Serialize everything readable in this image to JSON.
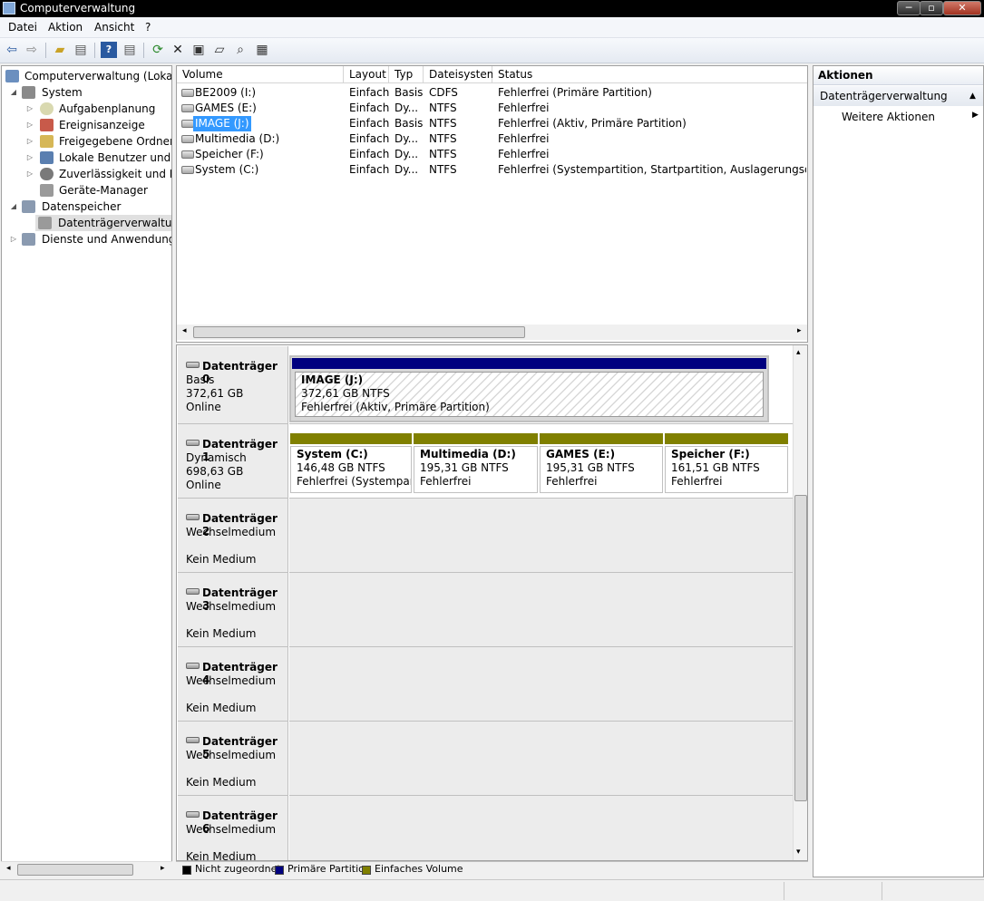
{
  "window": {
    "title": "Computerverwaltung",
    "min": "─",
    "max": "▫",
    "close": "✕"
  },
  "menu": [
    "Datei",
    "Aktion",
    "Ansicht",
    "?"
  ],
  "toolbar": [
    "back-icon",
    "forward-icon",
    "up-folder-icon",
    "show-tree-icon",
    "help-icon",
    "console-view-icon",
    "refresh-icon",
    "delete-icon",
    "properties-icon",
    "open-folder-icon",
    "search-icon",
    "export-icon"
  ],
  "tree": {
    "root": "Computerverwaltung (Lokal)",
    "items": [
      {
        "label": "System",
        "level": 1,
        "arrow": "◢"
      },
      {
        "label": "Aufgabenplanung",
        "level": 2,
        "arrow": "▷"
      },
      {
        "label": "Ereignisanzeige",
        "level": 2,
        "arrow": "▷"
      },
      {
        "label": "Freigegebene Ordner",
        "level": 2,
        "arrow": "▷"
      },
      {
        "label": "Lokale Benutzer und Gruppen",
        "level": 2,
        "arrow": "▷"
      },
      {
        "label": "Zuverlässigkeit und Leistung",
        "level": 2,
        "arrow": "▷"
      },
      {
        "label": "Geräte-Manager",
        "level": 2,
        "arrow": ""
      },
      {
        "label": "Datenspeicher",
        "level": 1,
        "arrow": "◢"
      },
      {
        "label": "Datenträgerverwaltung",
        "level": 2,
        "arrow": ""
      },
      {
        "label": "Dienste und Anwendungen",
        "level": 1,
        "arrow": "▷"
      }
    ]
  },
  "volumes": {
    "columns": [
      "Volume",
      "Layout",
      "Typ",
      "Dateisystem",
      "Status"
    ],
    "rows": [
      [
        "BE2009 (I:)",
        "Einfach",
        "Basis",
        "CDFS",
        "Fehlerfrei (Primäre Partition)"
      ],
      [
        "GAMES (E:)",
        "Einfach",
        "Dy...",
        "NTFS",
        "Fehlerfrei"
      ],
      [
        "IMAGE (J:)",
        "Einfach",
        "Basis",
        "NTFS",
        "Fehlerfrei (Aktiv, Primäre Partition)"
      ],
      [
        "Multimedia (D:)",
        "Einfach",
        "Dy...",
        "NTFS",
        "Fehlerfrei"
      ],
      [
        "Speicher (F:)",
        "Einfach",
        "Dy...",
        "NTFS",
        "Fehlerfrei"
      ],
      [
        "System (C:)",
        "Einfach",
        "Dy...",
        "NTFS",
        "Fehlerfrei (Systempartition, Startpartition, Auslagerungsdatei, Abs"
      ]
    ],
    "selected_row": 2
  },
  "disks": [
    {
      "name": "Datenträger 0",
      "type": "Basis",
      "size": "372,61 GB",
      "state": "Online",
      "partitions": [
        {
          "name": "IMAGE  (J:)",
          "fs": "372,61 GB NTFS",
          "status": "Fehlerfrei (Aktiv, Primäre Partition)"
        }
      ]
    },
    {
      "name": "Datenträger 1",
      "type": "Dynamisch",
      "size": "698,63 GB",
      "state": "Online",
      "partitions": [
        {
          "name": "System  (C:)",
          "fs": "146,48 GB NTFS",
          "status": "Fehlerfrei (Systempartition, Startpartition, Auslagerungsdatei)"
        },
        {
          "name": "Multimedia  (D:)",
          "fs": "195,31 GB NTFS",
          "status": "Fehlerfrei"
        },
        {
          "name": "GAMES  (E:)",
          "fs": "195,31 GB NTFS",
          "status": "Fehlerfrei"
        },
        {
          "name": "Speicher  (F:)",
          "fs": "161,51 GB NTFS",
          "status": "Fehlerfrei"
        }
      ]
    },
    {
      "name": "Datenträger 2",
      "type": "Wechselmedium",
      "state": "Kein Medium"
    },
    {
      "name": "Datenträger 3",
      "type": "Wechselmedium",
      "state": "Kein Medium"
    },
    {
      "name": "Datenträger 4",
      "type": "Wechselmedium",
      "state": "Kein Medium"
    },
    {
      "name": "Datenträger 5",
      "type": "Wechselmedium",
      "state": "Kein Medium"
    },
    {
      "name": "Datenträger 6",
      "type": "Wechselmedium",
      "state": "Kein Medium"
    }
  ],
  "legend": [
    {
      "label": "Nicht zugeordnet",
      "color": "#000000"
    },
    {
      "label": "Primäre Partition",
      "color": "#00007f"
    },
    {
      "label": "Einfaches Volume",
      "color": "#808000"
    }
  ],
  "actions": {
    "header": "Aktionen",
    "section": "Datenträgerverwaltung",
    "more": "Weitere Aktionen"
  },
  "colors": {
    "primary_bar": "#00007f",
    "simple_bar": "#808000",
    "selection": "#3399ff"
  }
}
